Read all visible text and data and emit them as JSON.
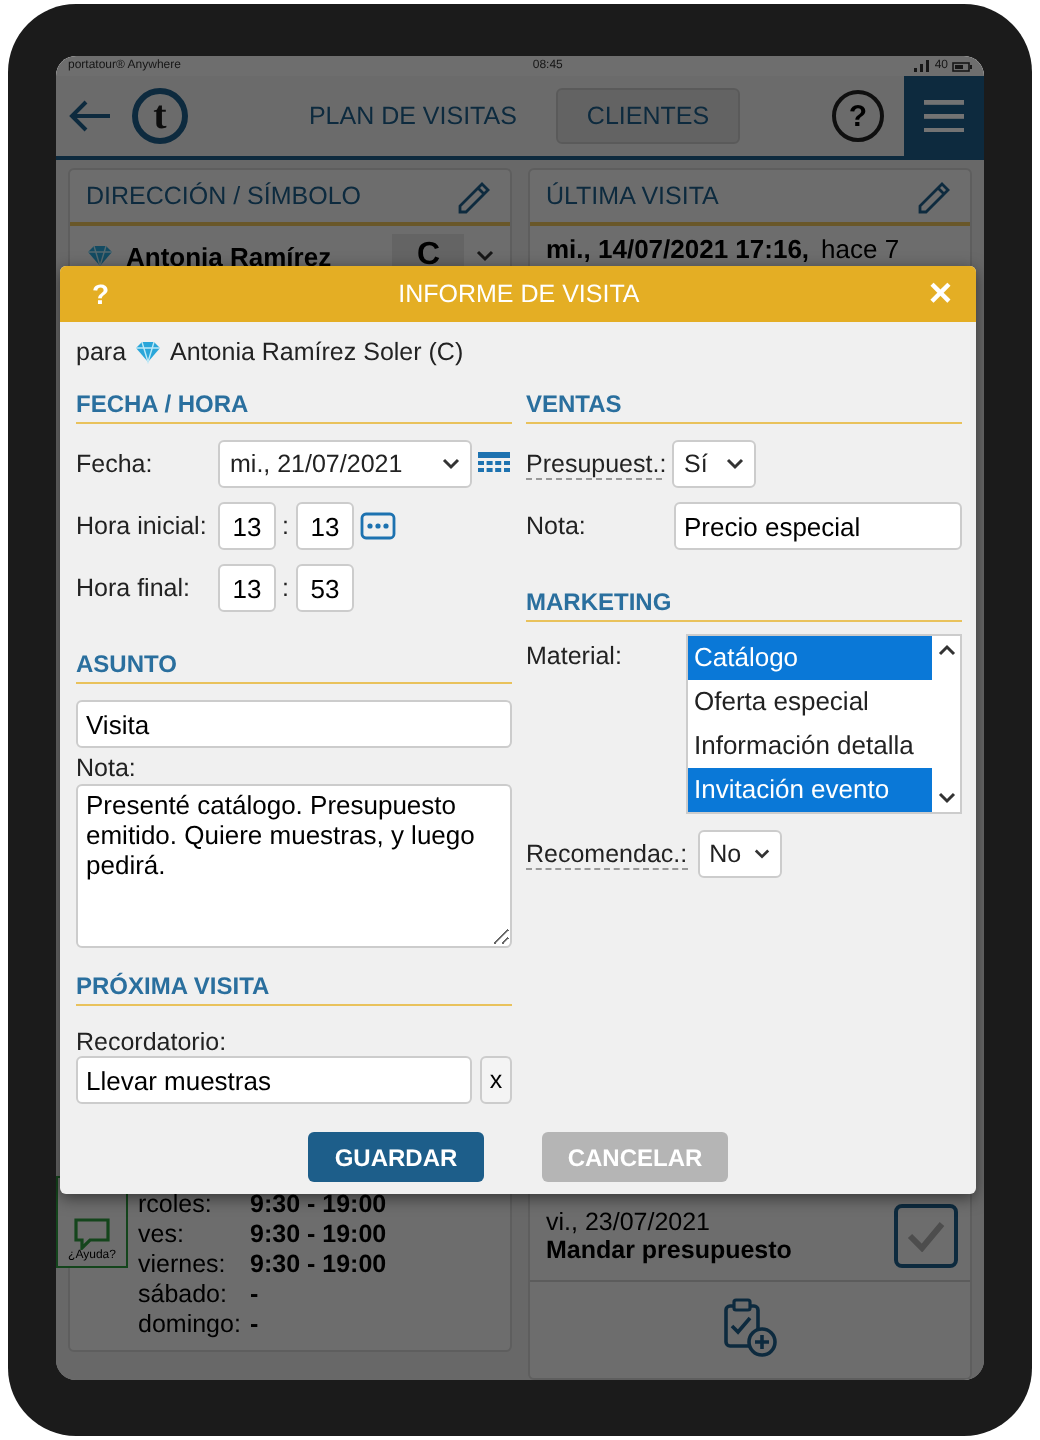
{
  "status_bar": {
    "carrier": "portatour® Anywhere",
    "time": "08:45",
    "battery": "40"
  },
  "header": {
    "logo_letter": "t",
    "nav": [
      {
        "label": "PLAN DE VISITAS",
        "selected": true
      },
      {
        "label": "CLIENTES",
        "selected": false
      }
    ],
    "help": "?"
  },
  "address_panel": {
    "title": "DIRECCIÓN / SÍMBOLO",
    "customer": "Antonia Ramírez",
    "category": "C",
    "hours": [
      {
        "day": "rcoles:",
        "time": "9:30 - 19:00"
      },
      {
        "day": "ves:",
        "time": "9:30 - 19:00"
      },
      {
        "day": "viernes:",
        "time": "9:30 - 19:00"
      },
      {
        "day": "sábado:",
        "time": "-"
      },
      {
        "day": "domingo:",
        "time": "-"
      }
    ]
  },
  "last_visit_panel": {
    "title": "ÚLTIMA VISITA",
    "date": "mi., 14/07/2021 17:16,",
    "ago": "hace 7",
    "task": {
      "date": "vi., 23/07/2021",
      "title": "Mandar presupuesto",
      "done": false
    }
  },
  "help_badge": "¿Ayuda?",
  "dialog": {
    "title": "INFORME DE VISITA",
    "help": "?",
    "close": "×",
    "for_prefix": "para",
    "for_name": "Antonia Ramírez Soler (C)",
    "date_time": {
      "heading": "FECHA / HORA",
      "date_label": "Fecha:",
      "date": "mi., 21/07/2021",
      "times": [
        {
          "label": "Hora inicial:",
          "hours": "13",
          "separator": ":",
          "minutes": "13",
          "picker": true
        },
        {
          "label": "Hora final:",
          "hours": "13",
          "separator": ":",
          "minutes": "53",
          "picker": false
        }
      ]
    },
    "subject": {
      "heading": "ASUNTO",
      "value": "Visita",
      "note_label": "Nota:",
      "note": "Presenté catálogo. Presupuesto emitido. Quiere muestras, y luego pedirá."
    },
    "next_visit": {
      "heading": "PRÓXIMA VISITA",
      "label": "Recordatorio:",
      "value": "Llevar muestras",
      "clear": "x"
    },
    "sales": {
      "heading": "VENTAS",
      "quote_label": "Presupuest.:",
      "quote": "Sí",
      "note_label": "Nota:",
      "note": "Precio especial"
    },
    "marketing": {
      "heading": "MARKETING",
      "material_label": "Material:",
      "materials": [
        {
          "label": "Catálogo",
          "selected": true
        },
        {
          "label": "Oferta especial",
          "selected": false
        },
        {
          "label": "Información detalla",
          "selected": false
        },
        {
          "label": "Invitación evento",
          "selected": true
        }
      ],
      "recommend_label": "Recomendac.:",
      "recommend": "No"
    },
    "buttons": [
      {
        "label": "GUARDAR",
        "kind": "primary"
      },
      {
        "label": "CANCELAR",
        "kind": "secondary"
      }
    ]
  }
}
